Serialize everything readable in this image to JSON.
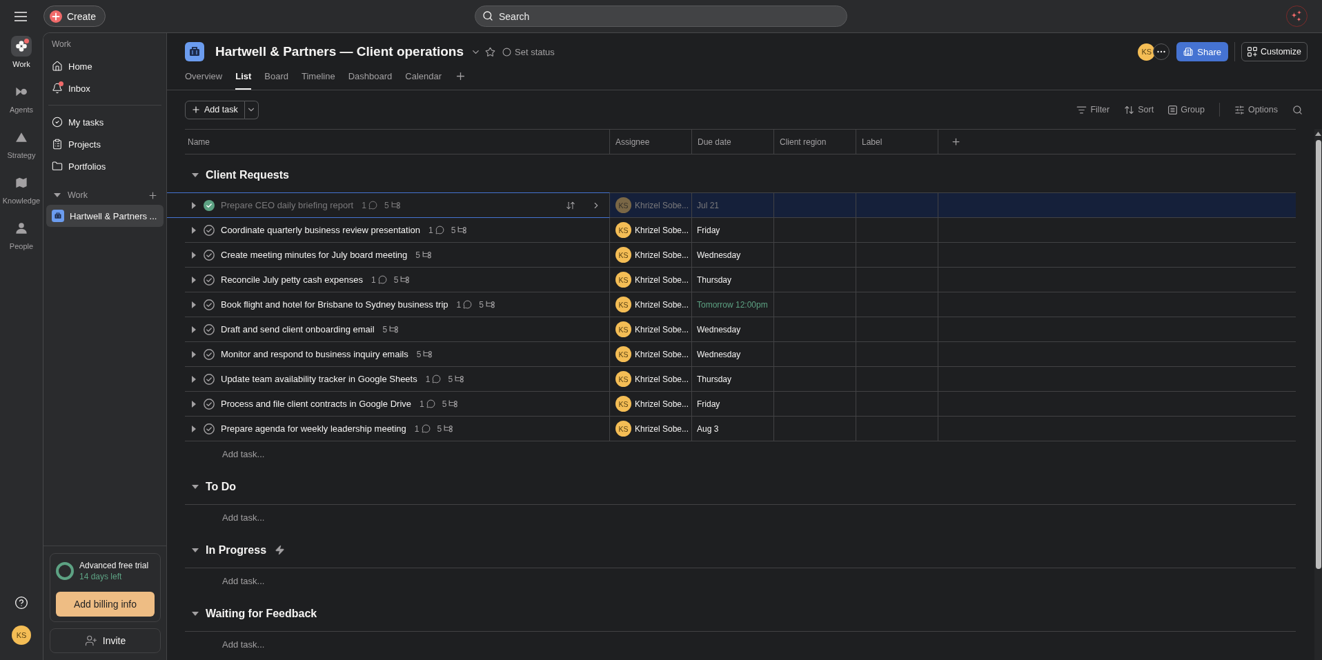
{
  "top_bar": {
    "create_label": "Create",
    "search_placeholder": "Search"
  },
  "rail": {
    "items": [
      {
        "label": "Work",
        "selected": true,
        "unread": true
      },
      {
        "label": "Agents",
        "selected": false,
        "unread": false
      },
      {
        "label": "Strategy",
        "selected": false,
        "unread": false
      },
      {
        "label": "Knowledge",
        "selected": false,
        "unread": false
      },
      {
        "label": "People",
        "selected": false,
        "unread": false
      }
    ],
    "user_initials": "KS"
  },
  "sidebar": {
    "heading": "Work",
    "primary": [
      {
        "label": "Home",
        "unread": false
      },
      {
        "label": "Inbox",
        "unread": true
      }
    ],
    "secondary": [
      "My tasks",
      "Projects",
      "Portfolios"
    ],
    "section": {
      "title": "Work",
      "expanded": true,
      "projects": [
        {
          "label": "Hartwell & Partners ...",
          "selected": true
        }
      ]
    },
    "trial": {
      "title": "Advanced free trial",
      "remaining": "14 days left",
      "button": "Add billing info"
    },
    "invite_label": "Invite"
  },
  "project": {
    "title": "Hartwell & Partners — Client operations",
    "starred": false,
    "status_label": "Set status",
    "tabs": [
      {
        "label": "Overview",
        "selected": false
      },
      {
        "label": "List",
        "selected": true
      },
      {
        "label": "Board",
        "selected": false
      },
      {
        "label": "Timeline",
        "selected": false
      },
      {
        "label": "Dashboard",
        "selected": false
      },
      {
        "label": "Calendar",
        "selected": false
      }
    ],
    "members": [
      {
        "initials": "KS"
      }
    ],
    "share_label": "Share",
    "customize_label": "Customize"
  },
  "toolbar": {
    "add_task_label": "Add task",
    "view_actions": [
      "Filter",
      "Sort",
      "Group"
    ],
    "options_label": "Options"
  },
  "table": {
    "columns": [
      "Name",
      "Assignee",
      "Due date",
      "Client region",
      "Label"
    ],
    "groups": [
      {
        "title": "Client Requests",
        "expanded": true,
        "rule": false,
        "add_task": "Add task...",
        "tasks": [
          {
            "name": "Prepare CEO daily briefing report",
            "expanded": false,
            "completed": true,
            "selected": true,
            "comments": "1",
            "subtasks": "5",
            "assignee": {
              "initials": "KS",
              "name": "Khrizel Sobe..."
            },
            "due": "Jul 21",
            "due_soon": false
          },
          {
            "name": "Coordinate quarterly business review presentation",
            "expanded": false,
            "completed": false,
            "selected": false,
            "comments": "1",
            "subtasks": "5",
            "assignee": {
              "initials": "KS",
              "name": "Khrizel Sobe..."
            },
            "due": "Friday",
            "due_soon": false
          },
          {
            "name": "Create meeting minutes for July board meeting",
            "expanded": false,
            "completed": false,
            "selected": false,
            "subtasks": "5",
            "assignee": {
              "initials": "KS",
              "name": "Khrizel Sobe..."
            },
            "due": "Wednesday",
            "due_soon": false
          },
          {
            "name": "Reconcile July petty cash expenses",
            "expanded": false,
            "completed": false,
            "selected": false,
            "comments": "1",
            "subtasks": "5",
            "assignee": {
              "initials": "KS",
              "name": "Khrizel Sobe..."
            },
            "due": "Thursday",
            "due_soon": false
          },
          {
            "name": "Book flight and hotel for Brisbane to Sydney business trip",
            "expanded": false,
            "completed": false,
            "selected": false,
            "comments": "1",
            "subtasks": "5",
            "assignee": {
              "initials": "KS",
              "name": "Khrizel Sobe..."
            },
            "due": "Tomorrow 12:00pm",
            "due_soon": true
          },
          {
            "name": "Draft and send client onboarding email",
            "expanded": false,
            "completed": false,
            "selected": false,
            "subtasks": "5",
            "assignee": {
              "initials": "KS",
              "name": "Khrizel Sobe..."
            },
            "due": "Wednesday",
            "due_soon": false
          },
          {
            "name": "Monitor and respond to business inquiry emails",
            "expanded": false,
            "completed": false,
            "selected": false,
            "subtasks": "5",
            "assignee": {
              "initials": "KS",
              "name": "Khrizel Sobe..."
            },
            "due": "Wednesday",
            "due_soon": false
          },
          {
            "name": "Update team availability tracker in Google Sheets",
            "expanded": false,
            "completed": false,
            "selected": false,
            "comments": "1",
            "subtasks": "5",
            "assignee": {
              "initials": "KS",
              "name": "Khrizel Sobe..."
            },
            "due": "Thursday",
            "due_soon": false
          },
          {
            "name": "Process and file client contracts in Google Drive",
            "expanded": false,
            "completed": false,
            "selected": false,
            "comments": "1",
            "subtasks": "5",
            "assignee": {
              "initials": "KS",
              "name": "Khrizel Sobe..."
            },
            "due": "Friday",
            "due_soon": false
          },
          {
            "name": "Prepare agenda for weekly leadership meeting",
            "expanded": false,
            "completed": false,
            "selected": false,
            "comments": "1",
            "subtasks": "5",
            "assignee": {
              "initials": "KS",
              "name": "Khrizel Sobe..."
            },
            "due": "Aug 3",
            "due_soon": false
          }
        ]
      },
      {
        "title": "To Do",
        "expanded": true,
        "rule": false,
        "add_task": "Add task..."
      },
      {
        "title": "In Progress",
        "expanded": true,
        "rule": true,
        "add_task": "Add task..."
      },
      {
        "title": "Waiting for Feedback",
        "expanded": true,
        "rule": false,
        "add_task": "Add task..."
      }
    ]
  }
}
